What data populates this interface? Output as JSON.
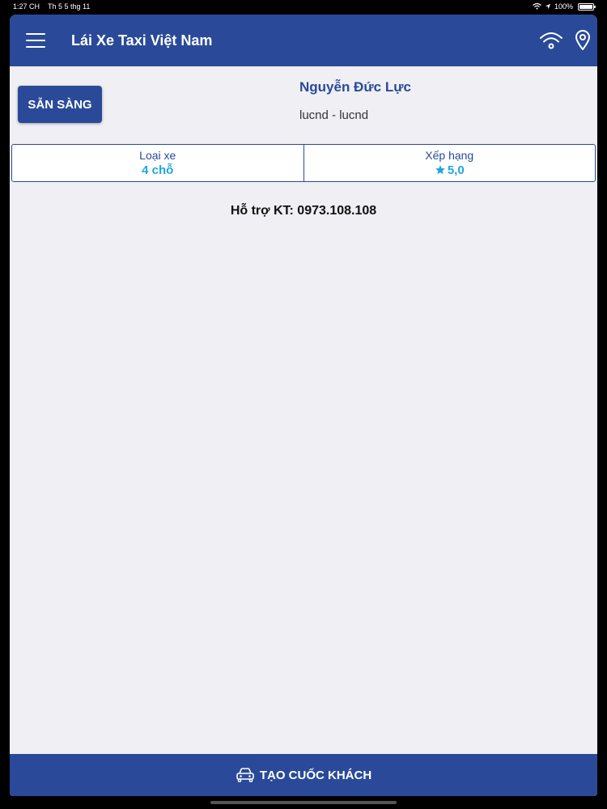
{
  "status_bar": {
    "time": "1:27 CH",
    "date": "Th 5 5 thg 11",
    "battery": "100%",
    "icons": [
      "wifi-icon",
      "location-arrow-icon",
      "battery-icon"
    ]
  },
  "nav": {
    "title": "Lái Xe Taxi Việt Nam",
    "icons": [
      "menu-icon",
      "wifi-icon",
      "location-pin-icon"
    ]
  },
  "driver": {
    "status_button": "SẴN SÀNG",
    "name": "Nguyễn Đức Lực",
    "username": "lucnd - lucnd"
  },
  "info": {
    "vehicle_type_label": "Loại xe",
    "vehicle_type_value": "4 chỗ",
    "rating_label": "Xếp hạng",
    "rating_value": "5,0"
  },
  "support": {
    "text": "Hỗ trợ KT: 0973.108.108"
  },
  "bottom_bar": {
    "label": "TẠO CUỐC KHÁCH",
    "icon": "car-icon"
  },
  "colors": {
    "primary": "#2a4a99",
    "accent": "#1fa6e0",
    "background": "#efeff4"
  }
}
